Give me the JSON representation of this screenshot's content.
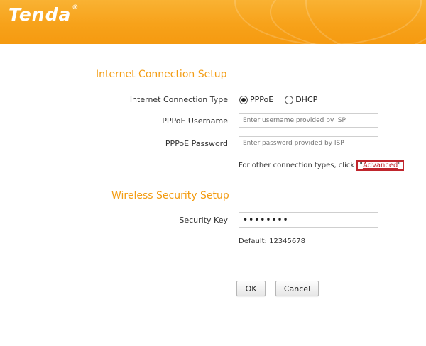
{
  "brand": {
    "logo_text": "Tenda",
    "logo_mark": "®"
  },
  "internet": {
    "title": "Internet Connection Setup",
    "connection_type_label": "Internet Connection Type",
    "options": [
      {
        "label": "PPPoE",
        "selected": true
      },
      {
        "label": "DHCP",
        "selected": false
      }
    ],
    "username_label": "PPPoE Username",
    "username_placeholder": "Enter username provided by ISP",
    "password_label": "PPPoE Password",
    "password_placeholder": "Enter password provided by ISP",
    "other_types_text": "For other connection types, click",
    "advanced_open_quote": "\"",
    "advanced_link": "Advanced",
    "advanced_close_quote": "\""
  },
  "wireless": {
    "title": "Wireless Security Setup",
    "key_label": "Security Key",
    "key_value": "••••••••",
    "default_text": "Default: 12345678"
  },
  "buttons": {
    "ok": "OK",
    "cancel": "Cancel"
  },
  "colors": {
    "header_orange": "#f7a21a",
    "section_title": "#f39c12",
    "highlight_red": "#c0262d"
  }
}
